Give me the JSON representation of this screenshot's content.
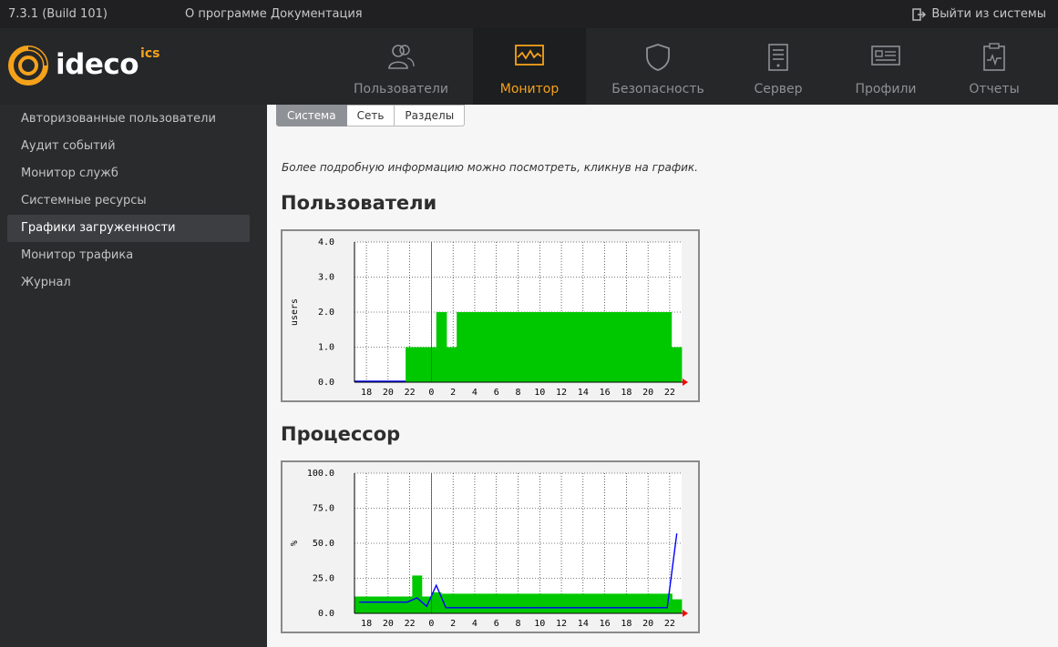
{
  "topbar": {
    "version": "7.3.1 (Build 101)",
    "about": "О программе",
    "docs": "Документация",
    "logout": "Выйти из системы"
  },
  "brand": {
    "name": "ideco",
    "suffix": "ics",
    "accent": "#f5a21b"
  },
  "nav": [
    {
      "label": "Пользователи",
      "icon": "users-icon"
    },
    {
      "label": "Монитор",
      "icon": "monitor-icon",
      "active": true
    },
    {
      "label": "Безопасность",
      "icon": "shield-icon"
    },
    {
      "label": "Сервер",
      "icon": "server-icon"
    },
    {
      "label": "Профили",
      "icon": "profile-card-icon"
    },
    {
      "label": "Отчеты",
      "icon": "report-clipboard-icon"
    }
  ],
  "sidebar": {
    "items": [
      {
        "label": "Авторизованные пользователи"
      },
      {
        "label": "Аудит событий"
      },
      {
        "label": "Монитор служб"
      },
      {
        "label": "Системные ресурсы"
      },
      {
        "label": "Графики загруженности",
        "active": true
      },
      {
        "label": "Монитор трафика"
      },
      {
        "label": "Журнал"
      }
    ]
  },
  "tabs": [
    {
      "label": "Система",
      "active": true
    },
    {
      "label": "Сеть"
    },
    {
      "label": "Разделы"
    }
  ],
  "hint": "Более подробную информацию можно посмотреть, кликнув на график.",
  "sections": {
    "users_title": "Пользователи",
    "cpu_title": "Процессор"
  },
  "chart_data": [
    {
      "type": "area",
      "title": "Пользователи",
      "ylabel": "users",
      "ylim": [
        0,
        4
      ],
      "yticks": [
        "0.0",
        "1.0",
        "2.0",
        "3.0",
        "4.0"
      ],
      "xticks": [
        "18",
        "20",
        "22",
        "0",
        "2",
        "4",
        "6",
        "8",
        "10",
        "12",
        "14",
        "16",
        "18",
        "20",
        "22"
      ],
      "grid": true,
      "colors": {
        "area": "#00c800",
        "line": "#0000ff",
        "marker": "#ff0000"
      },
      "series": [
        {
          "values": [
            0,
            0,
            0,
            0,
            0,
            1,
            1,
            1,
            2,
            1,
            2,
            2,
            2,
            2,
            2,
            2,
            2,
            2,
            2,
            2,
            2,
            2,
            2,
            2,
            2,
            2,
            2,
            2,
            2,
            2,
            2,
            1
          ]
        }
      ]
    },
    {
      "type": "area",
      "title": "Процессор",
      "ylabel": "%",
      "ylim": [
        0,
        100
      ],
      "yticks": [
        "0.0",
        "25.0",
        "50.0",
        "75.0",
        "100.0"
      ],
      "xticks": [
        "18",
        "20",
        "22",
        "0",
        "2",
        "4",
        "6",
        "8",
        "10",
        "12",
        "14",
        "16",
        "18",
        "20",
        "22"
      ],
      "grid": true,
      "colors": {
        "area": "#00c800",
        "line": "#0000ff",
        "marker": "#ff0000"
      },
      "series": [
        {
          "values": [
            12,
            12,
            12,
            12,
            12,
            12,
            27,
            12,
            15,
            14,
            14,
            14,
            14,
            14,
            14,
            14,
            14,
            14,
            14,
            14,
            14,
            14,
            14,
            14,
            14,
            14,
            14,
            14,
            14,
            14,
            14,
            14,
            14,
            10
          ]
        },
        {
          "values": [
            8,
            8,
            8,
            8,
            8,
            8,
            11,
            5,
            20,
            4,
            4,
            4,
            4,
            4,
            4,
            4,
            4,
            4,
            4,
            4,
            4,
            4,
            4,
            4,
            4,
            4,
            4,
            4,
            4,
            4,
            4,
            4,
            4,
            57
          ]
        }
      ]
    }
  ]
}
